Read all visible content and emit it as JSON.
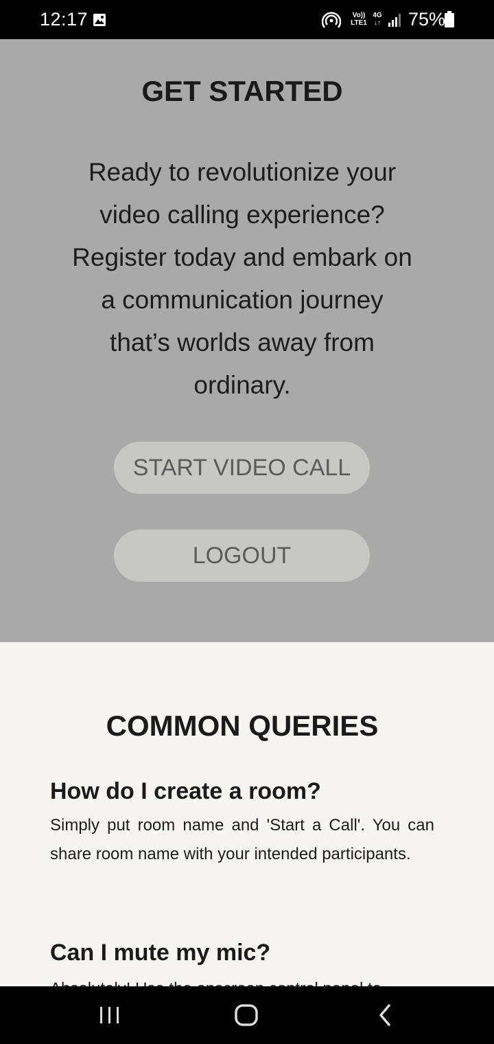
{
  "status_bar": {
    "time": "12:17",
    "volte_label_top": "Vo))",
    "volte_label_bottom": "LTE1",
    "network_label_top": "4G",
    "network_label_bottom": "↓↑",
    "battery": "75%"
  },
  "hero": {
    "title": "GET STARTED",
    "description": "Ready to revolutionize your video calling experience? Register today and embark on a communication journey that’s worlds away from ordinary.",
    "start_button_label": "START VIDEO CALL",
    "logout_button_label": "LOGOUT",
    "background_color": "#a9a9a9",
    "button_color": "#c7c7c6"
  },
  "faq": {
    "title": "COMMON QUERIES",
    "items": [
      {
        "question": "How do I create a room?",
        "answer": "Simply put room name and 'Start a Call'. You can share room name with your intended participants."
      },
      {
        "question": "Can I mute my mic?",
        "answer": "Absolutely! Use the onscreen control panel to"
      }
    ],
    "background_color": "#f6f5f3"
  },
  "nav_bar": {
    "icons": [
      "recents-icon",
      "home-icon",
      "back-icon"
    ]
  }
}
